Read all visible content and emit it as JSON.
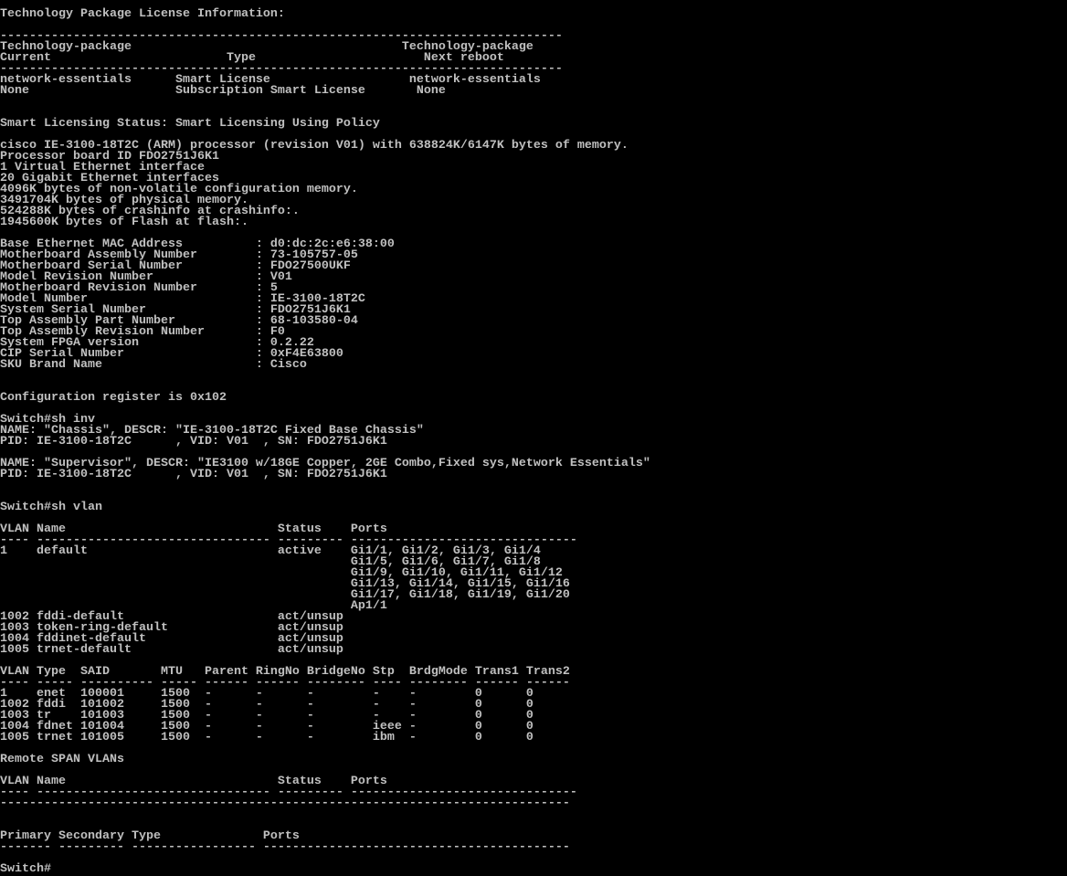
{
  "colors": {
    "background": "#000000",
    "foreground": "#c0c0c0"
  },
  "terminal": {
    "lines": [
      "Technology Package License Information:",
      "",
      "-----------------------------------------------------------------------------",
      "Technology-package                                     Technology-package",
      "Current                        Type                       Next reboot",
      "-----------------------------------------------------------------------------",
      "network-essentials      Smart License                   network-essentials",
      "None                    Subscription Smart License       None",
      "",
      "",
      "Smart Licensing Status: Smart Licensing Using Policy",
      "",
      "cisco IE-3100-18T2C (ARM) processor (revision V01) with 638824K/6147K bytes of memory.",
      "Processor board ID FDO2751J6K1",
      "1 Virtual Ethernet interface",
      "20 Gigabit Ethernet interfaces",
      "4096K bytes of non-volatile configuration memory.",
      "3491704K bytes of physical memory.",
      "524288K bytes of crashinfo at crashinfo:.",
      "1945600K bytes of Flash at flash:.",
      "",
      "Base Ethernet MAC Address          : d0:dc:2c:e6:38:00",
      "Motherboard Assembly Number        : 73-105757-05",
      "Motherboard Serial Number          : FDO27500UKF",
      "Model Revision Number              : V01",
      "Motherboard Revision Number        : 5",
      "Model Number                       : IE-3100-18T2C",
      "System Serial Number               : FDO2751J6K1",
      "Top Assembly Part Number           : 68-103580-04",
      "Top Assembly Revision Number       : F0",
      "System FPGA version                : 0.2.22",
      "CIP Serial Number                  : 0xF4E63800",
      "SKU Brand Name                     : Cisco",
      "",
      "",
      "Configuration register is 0x102",
      "",
      "Switch#sh inv",
      "NAME: \"Chassis\", DESCR: \"IE-3100-18T2C Fixed Base Chassis\"",
      "PID: IE-3100-18T2C      , VID: V01  , SN: FDO2751J6K1",
      "",
      "NAME: \"Supervisor\", DESCR: \"IE3100 w/18GE Copper, 2GE Combo,Fixed sys,Network Essentials\"",
      "PID: IE-3100-18T2C      , VID: V01  , SN: FDO2751J6K1",
      "",
      "",
      "Switch#sh vlan",
      "",
      "VLAN Name                             Status    Ports",
      "---- -------------------------------- --------- -------------------------------",
      "1    default                          active    Gi1/1, Gi1/2, Gi1/3, Gi1/4",
      "                                                Gi1/5, Gi1/6, Gi1/7, Gi1/8",
      "                                                Gi1/9, Gi1/10, Gi1/11, Gi1/12",
      "                                                Gi1/13, Gi1/14, Gi1/15, Gi1/16",
      "                                                Gi1/17, Gi1/18, Gi1/19, Gi1/20",
      "                                                Ap1/1",
      "1002 fddi-default                     act/unsup",
      "1003 token-ring-default               act/unsup",
      "1004 fddinet-default                  act/unsup",
      "1005 trnet-default                    act/unsup",
      "",
      "VLAN Type  SAID       MTU   Parent RingNo BridgeNo Stp  BrdgMode Trans1 Trans2",
      "---- ----- ---------- ----- ------ ------ -------- ---- -------- ------ ------",
      "1    enet  100001     1500  -      -      -        -    -        0      0",
      "1002 fddi  101002     1500  -      -      -        -    -        0      0",
      "1003 tr    101003     1500  -      -      -        -    -        0      0",
      "1004 fdnet 101004     1500  -      -      -        ieee -        0      0",
      "1005 trnet 101005     1500  -      -      -        ibm  -        0      0",
      "",
      "Remote SPAN VLANs",
      "",
      "VLAN Name                             Status    Ports",
      "---- -------------------------------- --------- -------------------------------",
      "------------------------------------------------------------------------------",
      "",
      "",
      "Primary Secondary Type              Ports",
      "------- --------- ----------------- ------------------------------------------",
      "",
      "Switch#"
    ]
  }
}
